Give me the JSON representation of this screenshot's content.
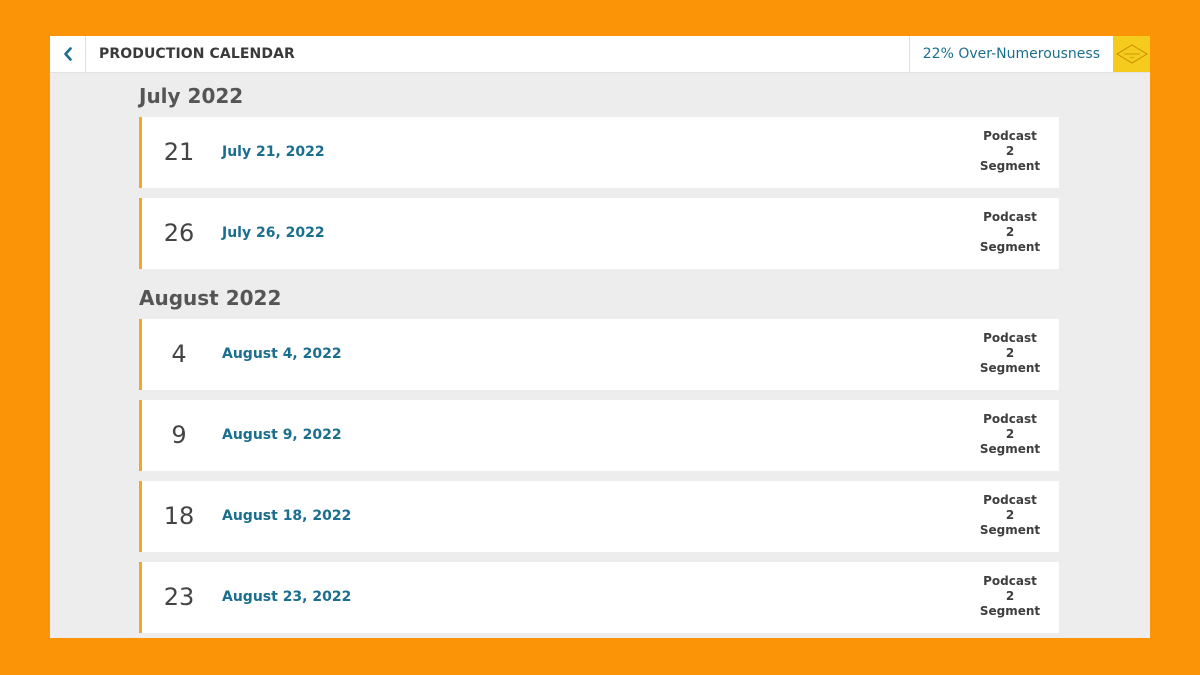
{
  "header": {
    "title": "PRODUCTION CALENDAR",
    "stat": "22% Over-Numerousness",
    "back_icon": "chevron-left-icon",
    "badge_icon": "diamond-badge-icon"
  },
  "colors": {
    "frame": "#FC9408",
    "accent_border": "#F5A52A",
    "link": "#1A6E8E",
    "badge": "#F5CB1E"
  },
  "months": [
    {
      "label": "July 2022",
      "entries": [
        {
          "day": "21",
          "date": "July 21, 2022",
          "type": [
            "Podcast",
            "2",
            "Segment"
          ]
        },
        {
          "day": "26",
          "date": "July 26, 2022",
          "type": [
            "Podcast",
            "2",
            "Segment"
          ]
        }
      ]
    },
    {
      "label": "August 2022",
      "entries": [
        {
          "day": "4",
          "date": "August 4, 2022",
          "type": [
            "Podcast",
            "2",
            "Segment"
          ]
        },
        {
          "day": "9",
          "date": "August 9, 2022",
          "type": [
            "Podcast",
            "2",
            "Segment"
          ]
        },
        {
          "day": "18",
          "date": "August 18, 2022",
          "type": [
            "Podcast",
            "2",
            "Segment"
          ]
        },
        {
          "day": "23",
          "date": "August 23, 2022",
          "type": [
            "Podcast",
            "2",
            "Segment"
          ]
        }
      ]
    }
  ]
}
